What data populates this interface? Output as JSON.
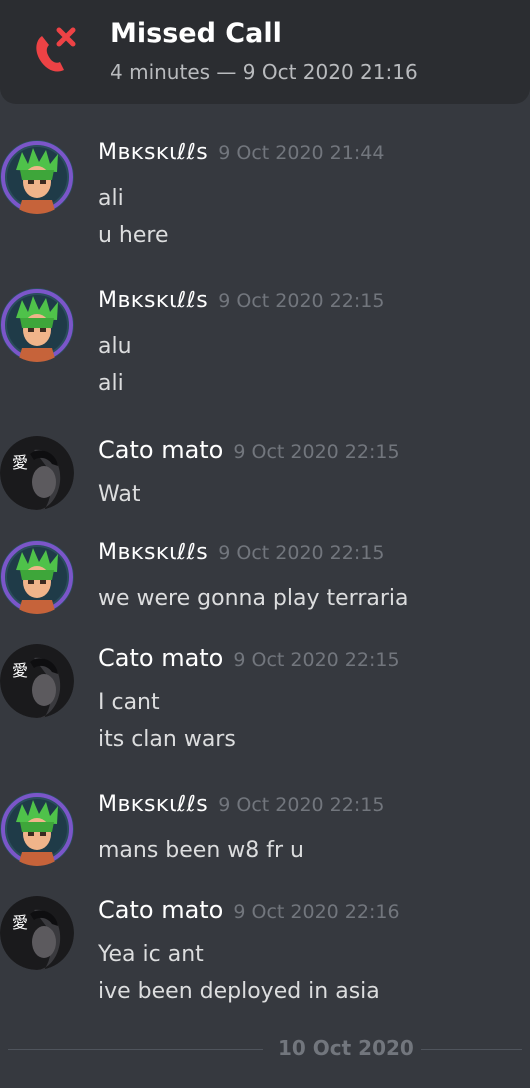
{
  "call": {
    "icon": "missed-call-icon",
    "title": "Missed Call",
    "subtitle": "4 minutes — 9 Oct 2020 21:16",
    "icon_color": "#ed4245"
  },
  "messages": [
    {
      "author": "Mʙᴋsᴋιℓℓs",
      "time": "9 Oct 2020 21:44",
      "lines": [
        "ali",
        "u here"
      ]
    },
    {
      "author": "Mʙᴋsᴋιℓℓs",
      "time": "9 Oct 2020 22:15",
      "lines": [
        "alu",
        "ali"
      ]
    },
    {
      "author": "Cato mato",
      "time": "9 Oct 2020 22:15",
      "lines": [
        "Wat"
      ]
    },
    {
      "author": "Mʙᴋsᴋιℓℓs",
      "time": "9 Oct 2020 22:15",
      "lines": [
        "we were gonna play terraria"
      ]
    },
    {
      "author": "Cato mato",
      "time": "9 Oct 2020 22:15",
      "lines": [
        "I cant",
        "its clan wars"
      ]
    },
    {
      "author": "Mʙᴋsᴋιℓℓs",
      "time": "9 Oct 2020 22:15",
      "lines": [
        "mans been w8 fr u"
      ]
    },
    {
      "author": "Cato mato",
      "time": "9 Oct 2020 22:16",
      "lines": [
        "Yea ic ant",
        "ive been deployed in asia"
      ]
    }
  ],
  "avatars": {
    "cato_glyph": "愛"
  },
  "date_divider": "10 Oct 2020",
  "colors": {
    "background": "#36393f",
    "call_bar": "#2b2d31",
    "author": "#ffffff",
    "timestamp": "#72767d",
    "message_text": "#dcddde"
  }
}
